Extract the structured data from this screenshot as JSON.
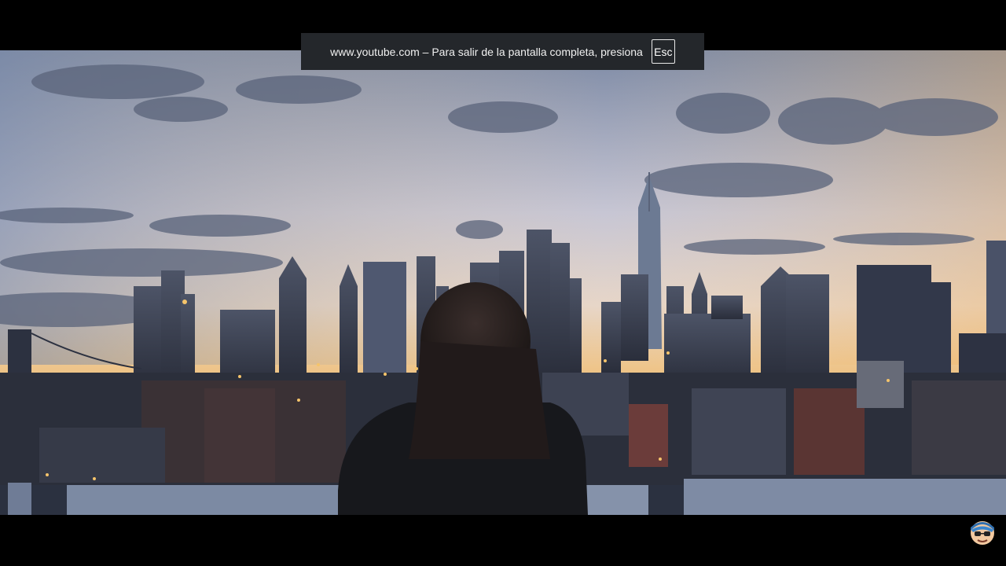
{
  "fullscreen_toast": {
    "message": "www.youtube.com – Para salir de la pantalla completa, presiona",
    "key": "Esc"
  },
  "video": {
    "scene": "video-frame"
  },
  "overlay": {
    "avatar_icon": "cartoon-avatar-icon"
  },
  "colors": {
    "toast_bg": "#24272b",
    "letterbox": "#000000"
  }
}
